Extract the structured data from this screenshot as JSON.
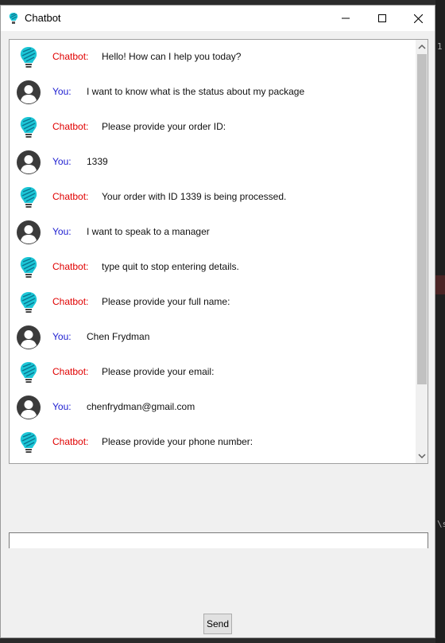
{
  "window": {
    "title": "Chatbot",
    "icon": "lightbulb-icon",
    "controls": [
      "minimize-icon",
      "maximize-icon",
      "close-icon"
    ]
  },
  "colors": {
    "bot_sender": "#e00000",
    "user_sender": "#1d1dd0",
    "bulb_accent": "#1cc6d6"
  },
  "messages": [
    {
      "sender": "Chatbot:",
      "role": "bot",
      "text": "Hello! How can I help you today?"
    },
    {
      "sender": "You:",
      "role": "user",
      "text": "I want to know what is the status about my package"
    },
    {
      "sender": "Chatbot:",
      "role": "bot",
      "text": "Please provide your order ID:"
    },
    {
      "sender": "You:",
      "role": "user",
      "text": "1339"
    },
    {
      "sender": "Chatbot:",
      "role": "bot",
      "text": "Your order with ID 1339 is being processed."
    },
    {
      "sender": "You:",
      "role": "user",
      "text": "I want to speak to a manager"
    },
    {
      "sender": "Chatbot:",
      "role": "bot",
      "text": "type quit to stop entering details."
    },
    {
      "sender": "Chatbot:",
      "role": "bot",
      "text": "Please provide your full name:"
    },
    {
      "sender": "You:",
      "role": "user",
      "text": "Chen Frydman"
    },
    {
      "sender": "Chatbot:",
      "role": "bot",
      "text": "Please provide your email:"
    },
    {
      "sender": "You:",
      "role": "user",
      "text": "chenfrydman@gmail.com"
    },
    {
      "sender": "Chatbot:",
      "role": "bot",
      "text": "Please provide your phone number:"
    }
  ],
  "input": {
    "value": "",
    "placeholder": ""
  },
  "send_label": "Send",
  "background": {
    "text_1": "1",
    "text_2": "\\s"
  }
}
